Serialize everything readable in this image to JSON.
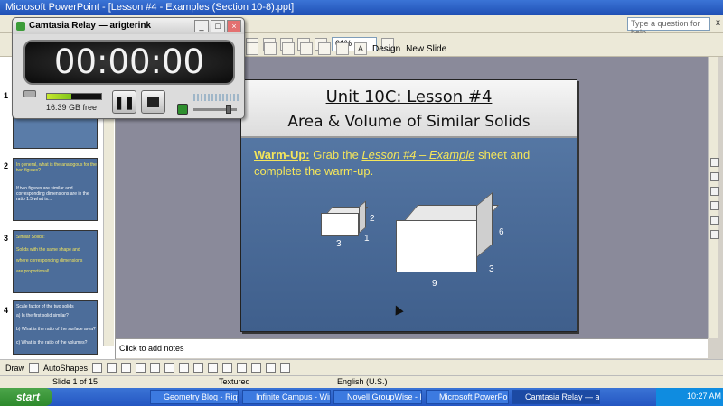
{
  "window": {
    "title": "Microsoft PowerPoint - [Lesson #4 - Examples (Section 10-8).ppt]"
  },
  "menubar": {
    "help_placeholder": "Type a question for help",
    "close": "x"
  },
  "toolbar": {
    "zoom": "61%",
    "design": "Design",
    "new_slide": "New Slide",
    "font_size_icon": "A"
  },
  "outline": {
    "thumbs": [
      {
        "num": "1",
        "lines": []
      },
      {
        "num": "2",
        "lines": [
          "In general, what is the analogous for the two figures?",
          "If two figures are similar and corresponding dimensions are in the ratio 1:5 what is..."
        ]
      },
      {
        "num": "3",
        "lines": [
          "Similar Solids:",
          "Solids with the same shape and",
          "where corresponding dimensions",
          "are proportional!"
        ]
      },
      {
        "num": "4",
        "lines": [
          "Scale factor of the two solids",
          "a) Is the first solid similar?",
          "b) What is the ratio of the surface area?",
          "c) What is the ratio of the volumes?"
        ]
      }
    ]
  },
  "slide": {
    "title": "Unit 10C:  Lesson #4",
    "subtitle": "Area & Volume of Similar Solids",
    "warmup_label": "Warm-Up:",
    "warmup_pre": "  Grab the ",
    "warmup_em": "Lesson #4 – Example",
    "warmup_post": " sheet and complete the warm-up.",
    "small_box": {
      "width_label": "3",
      "height_label": "2",
      "depth_label": "1"
    },
    "large_box": {
      "width_label": "9",
      "height_label": "6",
      "depth_label": "3"
    }
  },
  "notes": {
    "placeholder": "Click to add notes"
  },
  "drawbar": {
    "draw": "Draw",
    "autoshapes": "AutoShapes"
  },
  "status": {
    "slide": "Slide 1 of 15",
    "design": "Textured",
    "language": "English (U.S.)"
  },
  "taskbar": {
    "start": "start",
    "items": [
      "Geometry Blog - Rigt...",
      "Infinite Campus - Win...",
      "Novell GroupWise - M...",
      "Microsoft PowerPoint ...",
      "Camtasia Relay — ari..."
    ],
    "clock": "10:27 AM"
  },
  "camtasia": {
    "title": "Camtasia Relay — arigterink",
    "timer": "00:00:00",
    "disk_free": "16.39 GB free",
    "disk_level_percent": 45,
    "mic_level_percent": 85
  }
}
